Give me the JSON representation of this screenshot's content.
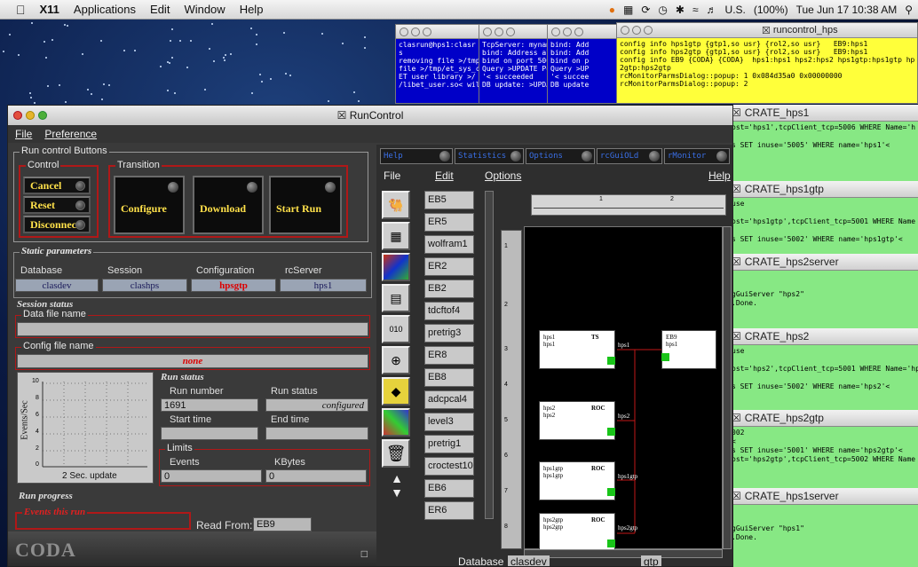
{
  "menubar": {
    "app": "X11",
    "items": [
      "Applications",
      "Edit",
      "Window",
      "Help"
    ],
    "status": {
      "lang": "U.S.",
      "battery": "(100%)",
      "clock": "Tue Jun 17  10:38 AM"
    }
  },
  "term1": {
    "text": "clasrun@hps1:clasr\ns\nremoving file >/tmp\nfile >/tmp/et_sys_c\nET user library >/\n/libet_user.so< wil"
  },
  "term2": {
    "text": "TcpServer: myname\nbind: Address al\nbind on port 500\nQuery >UPDATE Po\n'< succeeded\nDB update: >UPDA"
  },
  "term3": {
    "text": "bind: Add\nbind: Add\nbind on p\nQuery >UP\n'< succee\nDB update"
  },
  "runcontrol_hps": {
    "title": "runcontrol_hps",
    "text": "config info hps1gtp {gtp1,so usr} {rol2,so usr}   EB9:hps1\nconfig info hps2gtp {gtp1,so usr} {rol2,so usr}   EB9:hps1\nconfig info EB9 {CODA} {CODA}  hps1:hps1 hps2:hps2 hps1gtp:hps1gtp hp\n2gtp:hps2gtp\nrcMonitorParmsDialog::popup: 1 0x084d35a0 0x00000000\nrcMonitorParmsDialog::popup: 2"
  },
  "runcontrol": {
    "title": "RunControl",
    "menu": [
      "File",
      "Preference"
    ],
    "buttons_group": "Run control Buttons",
    "control": {
      "label": "Control",
      "cancel": "Cancel",
      "reset": "Reset",
      "disconnect": "Disconnect"
    },
    "transition": {
      "label": "Transition",
      "configure": "Configure",
      "download": "Download",
      "start": "Start Run"
    },
    "static": {
      "label": "Static parameters",
      "database_label": "Database",
      "database": "clasdev",
      "session_label": "Session",
      "session": "clashps",
      "config_label": "Configuration",
      "config": "hpsgtp",
      "server_label": "rcServer",
      "server": "hps1"
    },
    "session": {
      "label": "Session status",
      "data_file_label": "Data file name",
      "data_file": "",
      "config_file_label": "Config file name",
      "config_file": "none"
    },
    "graph": {
      "ylabel": "Events/Sec",
      "yticks": [
        "10",
        "8",
        "6",
        "4",
        "2",
        "0"
      ],
      "update": "2 Sec. update"
    },
    "run_status": {
      "label": "Run status",
      "run_number_label": "Run number",
      "run_number": "1691",
      "run_status_label": "Run status",
      "run_status": "configured",
      "start_label": "Start time",
      "end_label": "End time"
    },
    "limits": {
      "label": "Limits",
      "events_label": "Events",
      "events": "0",
      "kbytes_label": "KBytes",
      "kbytes": "0"
    },
    "progress": {
      "label": "Run progress",
      "events_label": "Events this run",
      "read_from_label": "Read From:",
      "read_from": "EB9"
    },
    "logo": "CODA",
    "cmd_buttons": [
      "Help",
      "Statistics",
      "Options",
      "rcGuiOLd",
      "rMonitor"
    ],
    "editor_menu": [
      "File",
      "Edit",
      "Options",
      "Help"
    ],
    "components": [
      "EB5",
      "ER5",
      "wolfram1",
      "ER2",
      "EB2",
      "tdcftof4",
      "pretrig3",
      "ER8",
      "EB8",
      "adcpcal4",
      "level3",
      "pretrig1",
      "croctest10",
      "EB6",
      "ER6"
    ],
    "ruler": [
      "1",
      "2"
    ],
    "vruler": [
      "1",
      "2",
      "3",
      "4",
      "5",
      "6",
      "7",
      "8"
    ],
    "nodes": [
      {
        "l1": "hps1",
        "l2": "hps1",
        "tag": "TS",
        "name": "hps1"
      },
      {
        "l1": "EB9",
        "l2": "hps1",
        "tag": "",
        "name": ""
      },
      {
        "l1": "hps2",
        "l2": "hps2",
        "tag": "ROC",
        "name": "hps2"
      },
      {
        "l1": "hps1gtp",
        "l2": "hps1gtp",
        "tag": "ROC",
        "name": "hps1gtp"
      },
      {
        "l1": "hps2gtp",
        "l2": "hps2gtp",
        "tag": "ROC",
        "name": "hps2gtp"
      }
    ],
    "database_label": "Database",
    "database_value": "clasdev",
    "config_value": "gtp"
  },
  "crates": [
    {
      "title": "CRATE_hps1",
      "text": "ost='hps1',tcpClient_tcp=5006 WHERE Name='h\n\ns SET inuse='5005' WHERE name='hps1'<"
    },
    {
      "title": "CRATE_hps1gtp",
      "text": "use\n\nost='hps1gtp',tcpClient_tcp=5001 WHERE Name\n\ns SET inuse='5002' WHERE name='hps1gtp'<"
    },
    {
      "title": "CRATE_hps2server",
      "text": "\n\ngGuiServer \"hps2\"\n.Done."
    },
    {
      "title": "CRATE_hps2",
      "text": "use\n\nost='hps2',tcpClient_tcp=5001 WHERE Name='hp\n\ns SET inuse='5002' WHERE name='hps2'<"
    },
    {
      "title": "CRATE_hps2gtp",
      "text": "002\n<\ns SET inuse='5001' WHERE name='hps2gtp'<\nost='hps2gtp',tcpClient_tcp=5002 WHERE Name"
    },
    {
      "title": "CRATE_hps1server",
      "text": "\n\ngGuiServer \"hps1\"\n.Done."
    }
  ]
}
